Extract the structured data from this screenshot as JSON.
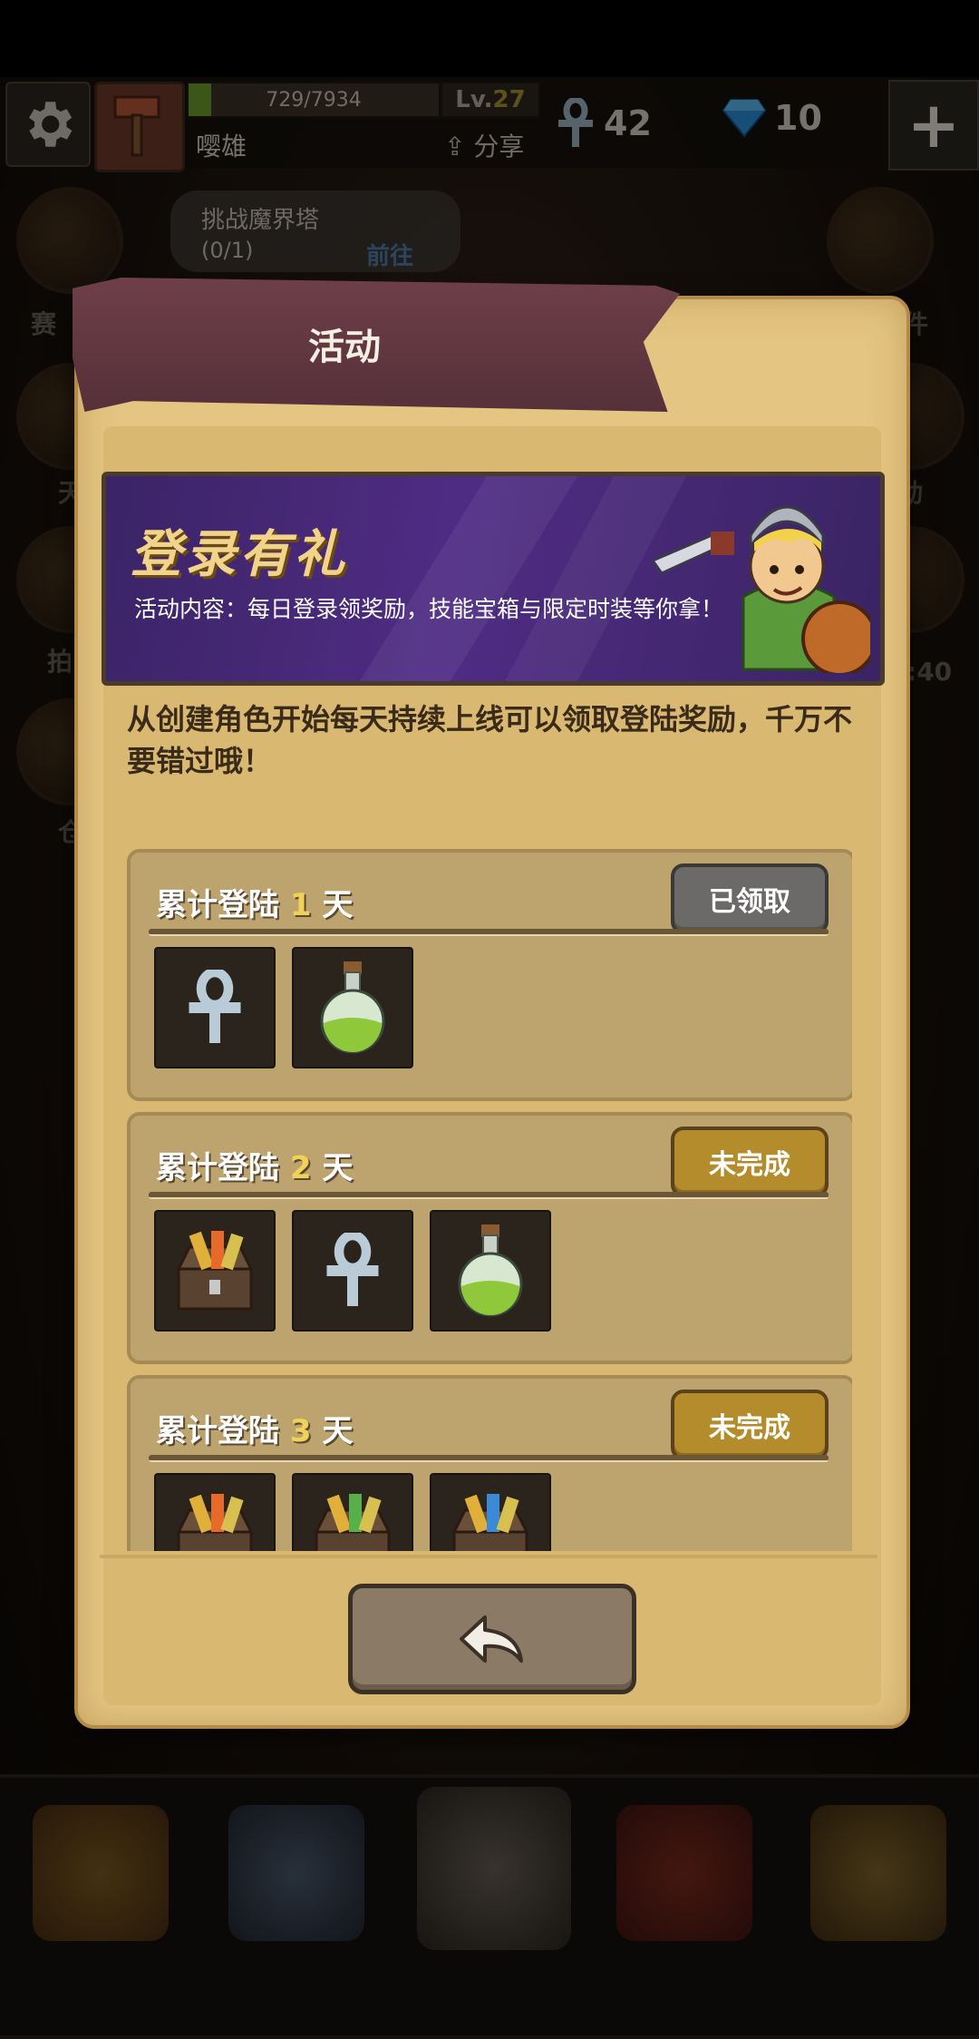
{
  "hud": {
    "xp_text": "729/7934",
    "xp_fraction": 0.092,
    "level_prefix": "Lv.",
    "level_value": "27",
    "player_name": "嘤雄",
    "share_label": "分享",
    "ankh_count": "42",
    "gem_count": "10",
    "plus_label": "+"
  },
  "quest": {
    "title": "挑战魔界塔",
    "count": "(0/1)",
    "go_label": "前往"
  },
  "background_labels": {
    "left_1": "赛",
    "left_2": "天",
    "left_3": "拍",
    "left_4": "仓",
    "right_1": "件",
    "right_2": "动",
    "right_3": ":40"
  },
  "modal": {
    "title": "活动",
    "banner_title": "登录有礼",
    "banner_desc": "活动内容：每日登录领奖励，技能宝箱与限定时装等你拿！",
    "intro": "从创建角色开始每天持续上线可以领取登陆奖励，千万不要错过哦！",
    "rewards": [
      {
        "title_prefix": "累计登陆 ",
        "day": "1",
        "title_suffix": " 天",
        "status": "已领取"
      },
      {
        "title_prefix": "累计登陆 ",
        "day": "2",
        "title_suffix": " 天",
        "status": "未完成"
      },
      {
        "title_prefix": "累计登陆 ",
        "day": "3",
        "title_suffix": " 天",
        "status": "未完成"
      }
    ]
  },
  "icons": {
    "settings": "gear-icon",
    "ankh": "ankh-icon",
    "gem": "diamond-icon",
    "potion": "green-potion-icon",
    "chest": "skill-chest-icon",
    "back": "back-arrow-icon"
  },
  "colors": {
    "panel": "#e4c581",
    "ribbon": "#5e3540",
    "banner": "#4b2b7c",
    "btn_done": "#6b6a68",
    "btn_todo": "#b58c2c",
    "day_highlight": "#f0d25a"
  }
}
